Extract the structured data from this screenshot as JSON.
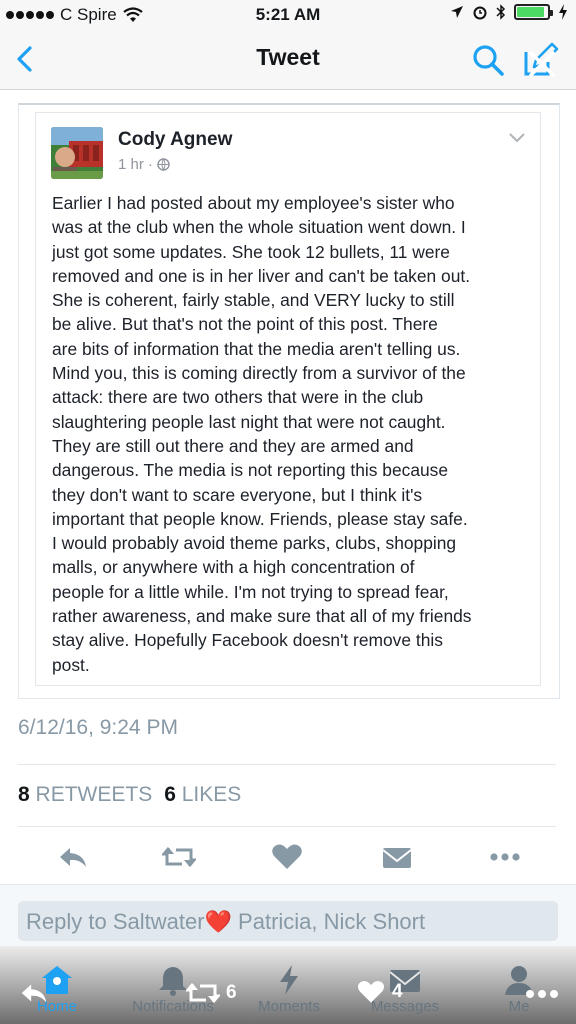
{
  "status_bar": {
    "carrier": "C Spire",
    "time": "5:21 AM",
    "battery_color": "#4cd964"
  },
  "nav": {
    "title": "Tweet",
    "back_icon": "chevron-left-icon",
    "search_icon": "search-icon",
    "compose_icon": "compose-icon"
  },
  "embedded_post": {
    "author": "Cody Agnew",
    "time": "1 hr",
    "privacy_icon": "globe-icon",
    "body": "Earlier I had posted about my employee's sister who\nwas at the club when the whole situation went down. I\njust got some updates. She took 12 bullets, 11 were\nremoved and one is in her liver and can't be taken out.\nShe is coherent, fairly stable, and VERY lucky to still\nbe alive. But that's not the point of this post. There\nare bits of information that the media aren't telling us.\nMind you, this is coming directly from a survivor of the\nattack: there are two others that were in the club\nslaughtering people last night that were not caught.\nThey are still out there and they are armed and\ndangerous. The media is not reporting this because\nthey don't want to scare everyone, but I think it's\nimportant that people know. Friends, please stay safe.\nI would probably avoid theme parks, clubs, shopping\nmalls, or anywhere with a high concentration of\npeople for a little while. I'm not trying to spread fear,\nrather awareness, and make sure that all of my friends\nstay alive. Hopefully Facebook doesn't remove this\npost."
  },
  "tweet": {
    "timestamp": "6/12/16, 9:24 PM",
    "retweets_count": "8",
    "retweets_label": "RETWEETS",
    "likes_count": "6",
    "likes_label": "LIKES"
  },
  "reply": {
    "placeholder_prefix": "Reply to Saltwater",
    "heart_emoji": "❤️",
    "placeholder_suffix": " Patricia, Nick Short"
  },
  "tabbar": {
    "items": [
      {
        "label": "Home",
        "icon": "home-icon",
        "active": true
      },
      {
        "label": "Notifications",
        "icon": "bell-icon",
        "active": false
      },
      {
        "label": "Moments",
        "icon": "lightning-icon",
        "active": false
      },
      {
        "label": "Messages",
        "icon": "envelope-icon",
        "active": false
      },
      {
        "label": "Me",
        "icon": "person-icon",
        "active": false
      }
    ],
    "overlay_retweet_count": "6",
    "overlay_like_count": "4"
  },
  "colors": {
    "accent": "#1da1f2",
    "muted": "#8899a6",
    "icon_gray": "#8899a6"
  }
}
